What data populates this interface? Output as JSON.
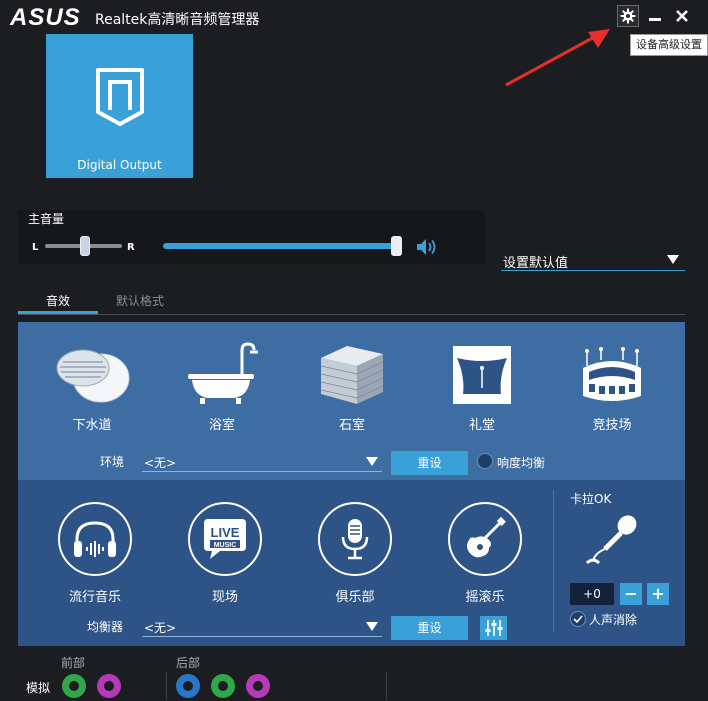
{
  "window": {
    "logo": "ASUS",
    "title": "Realtek高清晰音频管理器",
    "tooltip": "设备高级设置"
  },
  "device": {
    "label": "Digital Output"
  },
  "master_volume": {
    "title": "主音量",
    "left_label": "L",
    "right_label": "R",
    "balance": 0.5,
    "volume_percent": 100
  },
  "default_select": {
    "value": "设置默认值"
  },
  "tabs": [
    {
      "label": "音效",
      "active": true
    },
    {
      "label": "默认格式",
      "active": false
    }
  ],
  "environments": [
    {
      "label": "下水道",
      "icon": "sewer-icon"
    },
    {
      "label": "浴室",
      "icon": "bathtub-icon"
    },
    {
      "label": "石室",
      "icon": "stone-room-icon"
    },
    {
      "label": "礼堂",
      "icon": "auditorium-icon"
    },
    {
      "label": "竞技场",
      "icon": "arena-icon"
    }
  ],
  "environment_row": {
    "label": "环境",
    "value": "<无>",
    "reset_label": "重设",
    "loudness_label": "响度均衡"
  },
  "equalizer_presets": [
    {
      "label": "流行音乐",
      "icon": "headphones-icon"
    },
    {
      "label": "现场",
      "icon": "live-music-icon"
    },
    {
      "label": "俱乐部",
      "icon": "microphone-icon"
    },
    {
      "label": "摇滚乐",
      "icon": "guitar-icon"
    }
  ],
  "equalizer_row": {
    "label": "均衡器",
    "value": "<无>",
    "reset_label": "重设"
  },
  "karaoke": {
    "title": "卡拉OK",
    "value": "+0",
    "minus": "−",
    "plus": "+",
    "voice_cancel_label": "人声消除"
  },
  "jacks": {
    "row_label": "模拟",
    "front_label": "前部",
    "rear_label": "后部",
    "colors": {
      "green": "#2fa84a",
      "pink": "#b43ab8",
      "blue": "#2a77c8"
    }
  },
  "colors": {
    "accent": "#3aa0d8",
    "panel_top": "#3e6da3",
    "panel_bottom": "#2e5386",
    "background": "#1b1d20"
  }
}
